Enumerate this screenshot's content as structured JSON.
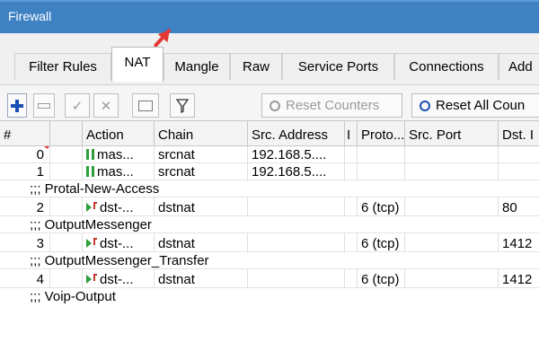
{
  "window": {
    "title": "Firewall"
  },
  "tabs": [
    {
      "label": "Filter Rules",
      "active": false
    },
    {
      "label": "NAT",
      "active": true
    },
    {
      "label": "Mangle",
      "active": false
    },
    {
      "label": "Raw",
      "active": false
    },
    {
      "label": "Service Ports",
      "active": false
    },
    {
      "label": "Connections",
      "active": false
    },
    {
      "label": "Add",
      "active": false
    }
  ],
  "toolbar": {
    "add_icon": "plus-icon",
    "remove_icon": "minus-icon",
    "enable_icon": "checkmark-icon",
    "disable_icon": "cross-icon",
    "comment_icon": "comment-icon",
    "filter_icon": "funnel-filter-icon",
    "reset_counters_label": "Reset Counters",
    "reset_all_counters_label": "Reset All Coun"
  },
  "table": {
    "columns": [
      "#",
      "Action",
      "Chain",
      "Src. Address",
      "I",
      "Proto...",
      "Src. Port",
      "Dst. I"
    ],
    "rows": [
      {
        "kind": "rule",
        "num": "0",
        "action_icon": "masquerade-icon",
        "action": "mas...",
        "chain": "srcnat",
        "src": "192.168.5....",
        "proto": "",
        "dst_port": ""
      },
      {
        "kind": "rule",
        "num": "1",
        "action_icon": "masquerade-icon",
        "action": "mas...",
        "chain": "srcnat",
        "src": "192.168.5....",
        "proto": "",
        "dst_port": ""
      },
      {
        "kind": "comment",
        "text": ";;; Protal-New-Access"
      },
      {
        "kind": "rule",
        "num": "2",
        "action_icon": "dst-nat-icon",
        "action": "dst-...",
        "chain": "dstnat",
        "src": "",
        "proto": "6 (tcp)",
        "dst_port": "80"
      },
      {
        "kind": "comment",
        "text": ";;; OutputMessenger"
      },
      {
        "kind": "rule",
        "num": "3",
        "action_icon": "dst-nat-icon",
        "action": "dst-...",
        "chain": "dstnat",
        "src": "",
        "proto": "6 (tcp)",
        "dst_port": "1412"
      },
      {
        "kind": "comment",
        "text": ";;; OutputMessenger_Transfer"
      },
      {
        "kind": "rule",
        "num": "4",
        "action_icon": "dst-nat-icon",
        "action": "dst-...",
        "chain": "dstnat",
        "src": "",
        "proto": "6 (tcp)",
        "dst_port": "1412"
      },
      {
        "kind": "comment",
        "text": ";;; Voip-Output"
      }
    ]
  },
  "colors": {
    "titlebar": "#3f82c4",
    "annotation_arrow": "#e53935",
    "add_button": "#1a4fb4"
  }
}
